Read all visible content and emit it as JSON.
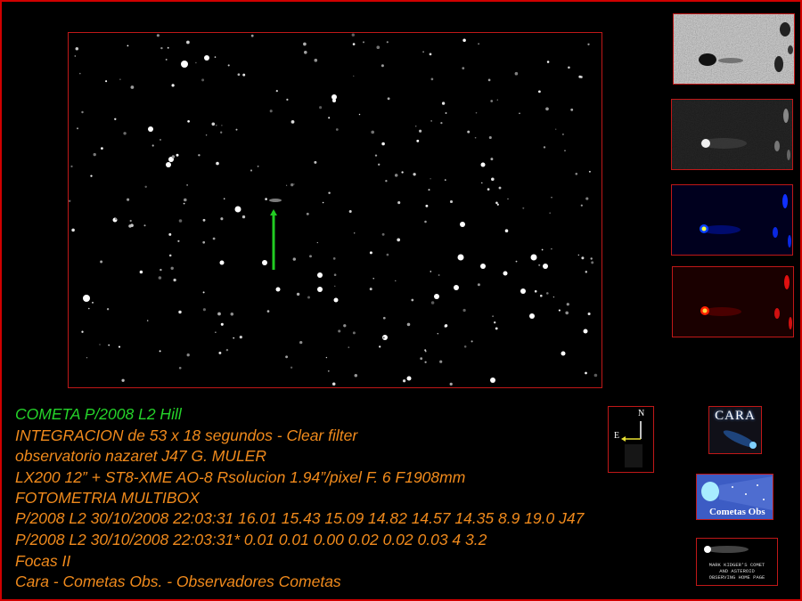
{
  "captions": [
    {
      "text": "COMETA  P/2008 L2 Hill",
      "color": "#25d32a"
    },
    {
      "text": "INTEGRACION de 53 x 18 segundos - Clear filter",
      "color": "#f08a1c"
    },
    {
      "text": "observatorio nazaret J47  G. MULER",
      "color": "#f08a1c"
    },
    {
      "text": "LX200 12” +  ST8-XME AO-8  Rsolucion 1.94”/pixel   F. 6      F1908mm",
      "color": "#f08a1c"
    },
    {
      "text": "FOTOMETRIA MULTIBOX",
      "color": "#f08a1c"
    },
    {
      "text": "P/2008 L2 30/10/2008 22:03:31 16.01 15.43 15.09 14.82 14.57 14.35 8.9 19.0 J47",
      "color": "#f08a1c"
    },
    {
      "text": "P/2008 L2 30/10/2008 22:03:31* 0.01 0.01 0.00 0.02 0.02 0.03 4 3.2",
      "color": "#f08a1c"
    },
    {
      "text": "Focas II",
      "color": "#f08a1c"
    },
    {
      "text": "Cara - Cometas Obs. - Observadores Cometas",
      "color": "#f08a1c"
    }
  ],
  "compass": {
    "north": "N",
    "east": "E"
  },
  "logos": {
    "cara": "CARA",
    "cometas": "Cometas  Obs",
    "kidger": "MARK KIDGER'S COMET\nAND ASTEROID\nOBSERVING HOME PAGE"
  },
  "colors": {
    "frame": "#d00000",
    "border": "#c01818",
    "arrow": "#22cc22",
    "caption_orange": "#f08a1c",
    "caption_green": "#25d32a"
  },
  "thumbnails": [
    "negative",
    "grayscale",
    "blue",
    "red"
  ]
}
